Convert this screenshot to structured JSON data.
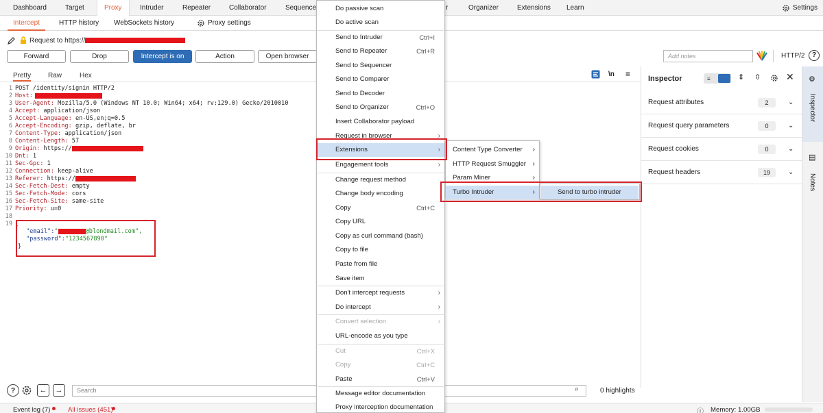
{
  "topnav": {
    "items": [
      "Dashboard",
      "Target",
      "Proxy",
      "Intruder",
      "Repeater",
      "Collaborator",
      "Sequencer",
      "r",
      "Organizer",
      "Extensions",
      "Learn"
    ],
    "settings": "Settings"
  },
  "subnav": {
    "items": [
      "Intercept",
      "HTTP history",
      "WebSockets history"
    ],
    "proxy_settings": "Proxy settings"
  },
  "request": {
    "label": "Request to https://"
  },
  "toolbar": {
    "forward": "Forward",
    "drop": "Drop",
    "intercept": "Intercept is on",
    "action": "Action",
    "open_browser": "Open browser",
    "notes_placeholder": "Add notes",
    "http_version": "HTTP/2",
    "help": "?"
  },
  "editor": {
    "tabs": [
      "Pretty",
      "Raw",
      "Hex"
    ],
    "wrap_icon": "\\n",
    "lines": [
      {
        "n": "1",
        "k": "",
        "v": "POST /identity/signin HTTP/2"
      },
      {
        "n": "2",
        "k": "Host:",
        "v": ""
      },
      {
        "n": "3",
        "k": "User-Agent:",
        "v": " Mozilla/5.0 (Windows NT 10.0; Win64; x64; rv:129.0) Gecko/2010010"
      },
      {
        "n": "4",
        "k": "Accept:",
        "v": " application/json"
      },
      {
        "n": "5",
        "k": "Accept-Language:",
        "v": " en-US,en;q=0.5"
      },
      {
        "n": "6",
        "k": "Accept-Encoding:",
        "v": " gzip, deflate, br"
      },
      {
        "n": "7",
        "k": "Content-Type:",
        "v": " application/json"
      },
      {
        "n": "8",
        "k": "Content-Length:",
        "v": " 57"
      },
      {
        "n": "9",
        "k": "Origin:",
        "v": " https://"
      },
      {
        "n": "10",
        "k": "Dnt:",
        "v": " 1"
      },
      {
        "n": "11",
        "k": "Sec-Gpc:",
        "v": " 1"
      },
      {
        "n": "12",
        "k": "Connection:",
        "v": " keep-alive"
      },
      {
        "n": "13",
        "k": "Referer:",
        "v": " https://"
      },
      {
        "n": "14",
        "k": "Sec-Fetch-Dest:",
        "v": " empty"
      },
      {
        "n": "15",
        "k": "Sec-Fetch-Mode:",
        "v": " cors"
      },
      {
        "n": "16",
        "k": "Sec-Fetch-Site:",
        "v": " same-site"
      },
      {
        "n": "17",
        "k": "Priority:",
        "v": " u=0"
      },
      {
        "n": "18",
        "k": "",
        "v": ""
      },
      {
        "n": "19",
        "k": "",
        "v": "{"
      }
    ],
    "body_email_key": "\"email\":",
    "body_email_val": "@blondmail.com\",",
    "body_pw_key": "\"password\":",
    "body_pw_val": "\"1234567890\"",
    "body_close": "}"
  },
  "inspector": {
    "title": "Inspector",
    "rows": [
      {
        "label": "Request attributes",
        "count": "2"
      },
      {
        "label": "Request query parameters",
        "count": "0"
      },
      {
        "label": "Request cookies",
        "count": "0"
      },
      {
        "label": "Request headers",
        "count": "19"
      }
    ],
    "side_tabs": [
      "Inspector",
      "Notes"
    ]
  },
  "menu": {
    "items": [
      {
        "label": "Do passive scan",
        "sc": "",
        "arrow": false,
        "disabled": false
      },
      {
        "label": "Do active scan",
        "sc": "",
        "arrow": false,
        "disabled": false
      },
      {
        "label": "Send to Intruder",
        "sc": "Ctrl+I",
        "arrow": false,
        "disabled": false
      },
      {
        "label": "Send to Repeater",
        "sc": "Ctrl+R",
        "arrow": false,
        "disabled": false
      },
      {
        "label": "Send to Sequencer",
        "sc": "",
        "arrow": false,
        "disabled": false
      },
      {
        "label": "Send to Comparer",
        "sc": "",
        "arrow": false,
        "disabled": false
      },
      {
        "label": "Send to Decoder",
        "sc": "",
        "arrow": false,
        "disabled": false
      },
      {
        "label": "Send to Organizer",
        "sc": "Ctrl+O",
        "arrow": false,
        "disabled": false
      },
      {
        "label": "Insert Collaborator payload",
        "sc": "",
        "arrow": false,
        "disabled": false
      },
      {
        "label": "Request in browser",
        "sc": "",
        "arrow": true,
        "disabled": false
      },
      {
        "label": "Extensions",
        "sc": "",
        "arrow": true,
        "disabled": false
      },
      {
        "label": "Engagement tools",
        "sc": "",
        "arrow": true,
        "disabled": false
      },
      {
        "label": "Change request method",
        "sc": "",
        "arrow": false,
        "disabled": false
      },
      {
        "label": "Change body encoding",
        "sc": "",
        "arrow": false,
        "disabled": false
      },
      {
        "label": "Copy",
        "sc": "Ctrl+C",
        "arrow": false,
        "disabled": false
      },
      {
        "label": "Copy URL",
        "sc": "",
        "arrow": false,
        "disabled": false
      },
      {
        "label": "Copy as curl command (bash)",
        "sc": "",
        "arrow": false,
        "disabled": false
      },
      {
        "label": "Copy to file",
        "sc": "",
        "arrow": false,
        "disabled": false
      },
      {
        "label": "Paste from file",
        "sc": "",
        "arrow": false,
        "disabled": false
      },
      {
        "label": "Save item",
        "sc": "",
        "arrow": false,
        "disabled": false
      },
      {
        "label": "Don't intercept requests",
        "sc": "",
        "arrow": true,
        "disabled": false
      },
      {
        "label": "Do intercept",
        "sc": "",
        "arrow": true,
        "disabled": false
      },
      {
        "label": "Convert selection",
        "sc": "",
        "arrow": true,
        "disabled": true
      },
      {
        "label": "URL-encode as you type",
        "sc": "",
        "arrow": false,
        "disabled": false
      },
      {
        "label": "Cut",
        "sc": "Ctrl+X",
        "arrow": false,
        "disabled": true
      },
      {
        "label": "Copy",
        "sc": "Ctrl+C",
        "arrow": false,
        "disabled": true
      },
      {
        "label": "Paste",
        "sc": "Ctrl+V",
        "arrow": false,
        "disabled": false
      },
      {
        "label": "Message editor documentation",
        "sc": "",
        "arrow": false,
        "disabled": false
      },
      {
        "label": "Proxy interception documentation",
        "sc": "",
        "arrow": false,
        "disabled": false
      }
    ]
  },
  "submenu": {
    "items": [
      "Content Type Converter",
      "HTTP Request Smuggler",
      "Param Miner",
      "Turbo Intruder"
    ],
    "turbo": [
      "Send to turbo intruder"
    ]
  },
  "bottom": {
    "search_placeholder": "Search",
    "highlights": "0 highlights",
    "event_log": "Event log (7)",
    "all_issues": "All issues (451)",
    "memory": "Memory: 1.00GB"
  },
  "colors": {
    "accent": "#e8643c",
    "primary": "#2e6db5",
    "highlight": "#cfe0f4",
    "frame": "#d6232b"
  }
}
